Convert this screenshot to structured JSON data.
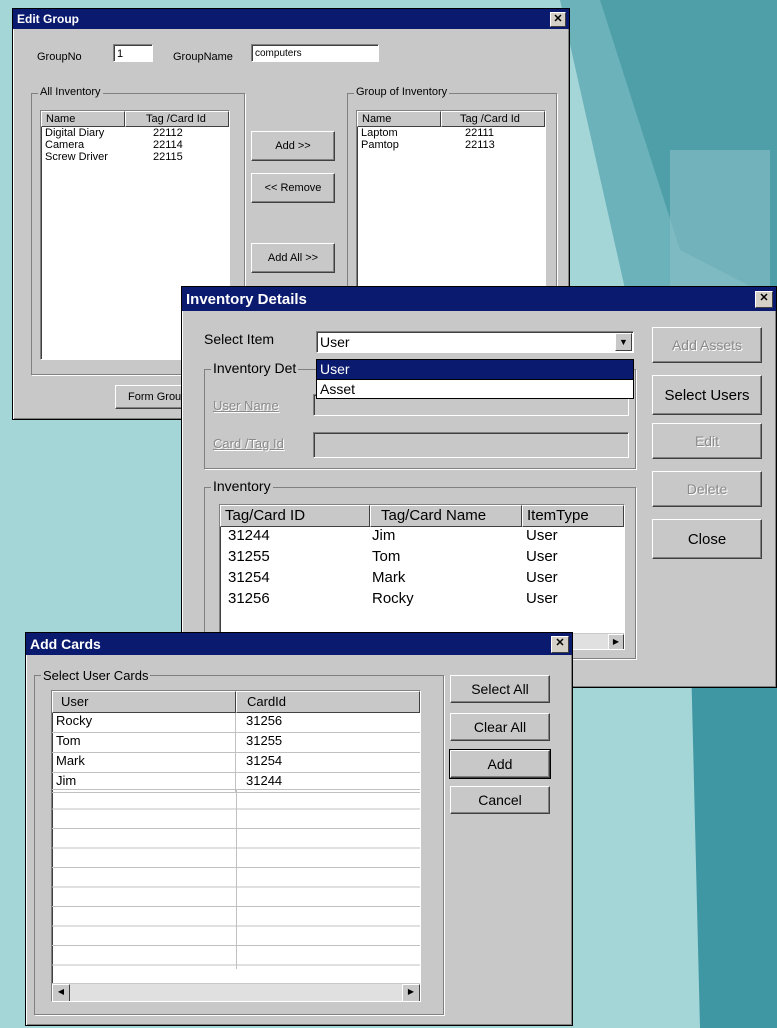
{
  "edit_group": {
    "title": "Edit Group",
    "group_no_label": "GroupNo",
    "group_no_value": "1",
    "group_name_label": "GroupName",
    "group_name_value": "computers",
    "all_inventory": {
      "legend": "All Inventory",
      "columns": [
        "Name",
        "Tag /Card Id"
      ],
      "rows": [
        [
          "Digital Diary",
          "22112"
        ],
        [
          "Camera",
          "22114"
        ],
        [
          "Screw Driver",
          "22115"
        ]
      ]
    },
    "group_inventory": {
      "legend": "Group of Inventory",
      "columns": [
        "Name",
        "Tag /Card Id"
      ],
      "rows": [
        [
          "Laptom",
          "22111"
        ],
        [
          "Pamtop",
          "22113"
        ]
      ]
    },
    "add_label": "Add >>",
    "remove_label": "<< Remove",
    "add_all_label": "Add All >>",
    "form_group_label": "Form Grou"
  },
  "inventory_details": {
    "title": "Inventory Details",
    "select_item_label": "Select Item",
    "select_item_value": "User",
    "dropdown_options": [
      "User",
      "Asset"
    ],
    "details_legend": "Inventory Det",
    "user_name_label": "User Name",
    "card_tag_label": "Card /Tag Id",
    "inventory_legend": "Inventory",
    "columns": [
      "Tag/Card ID",
      "Tag/Card Name",
      "ItemType"
    ],
    "rows": [
      [
        "31244",
        "Jim",
        "User"
      ],
      [
        "31255",
        "Tom",
        "User"
      ],
      [
        "31254",
        "Mark",
        "User"
      ],
      [
        "31256",
        "Rocky",
        "User"
      ]
    ],
    "add_assets_label": "Add Assets",
    "select_users_label": "Select Users",
    "edit_label": "Edit",
    "delete_label": "Delete",
    "close_label": "Close"
  },
  "add_cards": {
    "title": "Add Cards",
    "legend": "Select User Cards",
    "columns": [
      "User",
      "CardId"
    ],
    "rows": [
      [
        "Rocky",
        "31256"
      ],
      [
        "Tom",
        "31255"
      ],
      [
        "Mark",
        "31254"
      ],
      [
        "Jim",
        "31244"
      ]
    ],
    "select_all_label": "Select All",
    "clear_all_label": "Clear All",
    "add_label": "Add",
    "cancel_label": "Cancel"
  },
  "colors": {
    "titlebar": "#0a1a6e",
    "window_face": "#c8c8c8",
    "background": "#9fd3d6",
    "highlight": "#0a1a6e"
  }
}
